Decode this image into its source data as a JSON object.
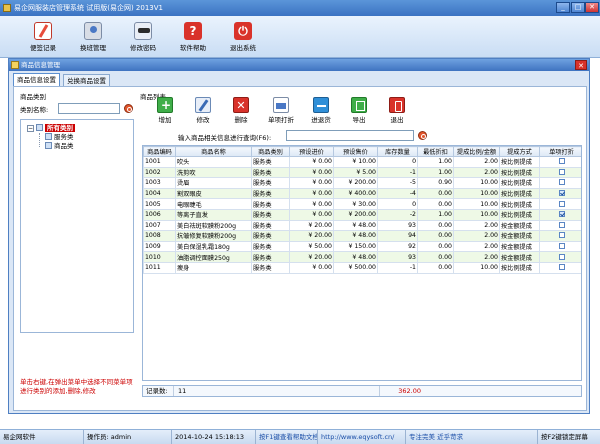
{
  "window": {
    "title": "易企网服装店管理系统 试用版(易企网) 2013V1"
  },
  "toolbar": [
    {
      "label": "便签记录",
      "icon": "note-icon"
    },
    {
      "label": "换班管理",
      "icon": "user-icon"
    },
    {
      "label": "修改密码",
      "icon": "key-icon"
    },
    {
      "label": "软件帮助",
      "icon": "help-icon"
    },
    {
      "label": "退出系统",
      "icon": "power-icon"
    }
  ],
  "dialog": {
    "title": "商品信息管理",
    "close": "✕",
    "tabs": [
      "商品信息设置",
      "兑换商品设置"
    ]
  },
  "category": {
    "section_label": "商品类别",
    "name_label": "类别名称:",
    "tree": {
      "root": "所有类别",
      "children": [
        "服务类",
        "商品类"
      ]
    },
    "hint": "单击右键,在弹出菜单中选择不同菜单项进行类别的添加,删除,修改"
  },
  "product": {
    "section_label": "商品列表",
    "buttons": [
      "增加",
      "修改",
      "删除",
      "单项打折",
      "进退货",
      "导出",
      "退出"
    ],
    "search_label": "输入商品相关信息进行查询(F6):",
    "columns": [
      "商品编码",
      "商品名称",
      "商品类别",
      "预设进价",
      "预设售价",
      "库存数量",
      "最低折扣",
      "提成比例/金额",
      "提成方式",
      "单项打折"
    ],
    "rows": [
      [
        "1001",
        "吹头",
        "服务类",
        "¥ 0.00",
        "¥ 10.00",
        "0",
        "1.00",
        "2.00",
        "按比例提成",
        false
      ],
      [
        "1002",
        "洗剪吹",
        "服务类",
        "¥ 0.00",
        "¥ 5.00",
        "-1",
        "1.00",
        "2.00",
        "按比例提成",
        false
      ],
      [
        "1003",
        "烫眉",
        "服务类",
        "¥ 0.00",
        "¥ 200.00",
        "-5",
        "0.90",
        "10.00",
        "按比例提成",
        false
      ],
      [
        "1004",
        "割双眼皮",
        "服务类",
        "¥ 0.00",
        "¥ 400.00",
        "-4",
        "0.00",
        "10.00",
        "按比例提成",
        true
      ],
      [
        "1005",
        "电眼睫毛",
        "服务类",
        "¥ 0.00",
        "¥ 30.00",
        "0",
        "0.00",
        "10.00",
        "按比例提成",
        false
      ],
      [
        "1006",
        "等离子直发",
        "服务类",
        "¥ 0.00",
        "¥ 200.00",
        "-2",
        "1.00",
        "10.00",
        "按比例提成",
        true
      ],
      [
        "1007",
        "美白祛斑软膜粉200g",
        "服务类",
        "¥ 20.00",
        "¥ 48.00",
        "93",
        "0.00",
        "2.00",
        "按金额提成",
        false
      ],
      [
        "1008",
        "抗皱修复软膜粉200g",
        "服务类",
        "¥ 20.00",
        "¥ 48.00",
        "94",
        "0.00",
        "2.00",
        "按金额提成",
        false
      ],
      [
        "1009",
        "美白保湿乳霜180g",
        "服务类",
        "¥ 50.00",
        "¥ 150.00",
        "92",
        "0.00",
        "2.00",
        "按金额提成",
        false
      ],
      [
        "1010",
        "油脂调控面膜250g",
        "服务类",
        "¥ 20.00",
        "¥ 48.00",
        "93",
        "0.00",
        "2.00",
        "按金额提成",
        false
      ],
      [
        "1011",
        "瘦身",
        "服务类",
        "¥ 0.00",
        "¥ 500.00",
        "-1",
        "0.00",
        "10.00",
        "按比例提成",
        false
      ]
    ],
    "footer": {
      "count_label": "记录数:",
      "count": "11",
      "sum": "362.00"
    }
  },
  "statusbar": {
    "company": "易企网软件",
    "operator": "操作员: admin",
    "datetime": "2014-10-24 15:18:13",
    "f1_help": "按F1键查看帮助文档",
    "website": "http://www.eqysoft.cn/",
    "slogan": "专注完美  近乎苛求",
    "f2_lock": "按F2键锁定屏幕"
  }
}
